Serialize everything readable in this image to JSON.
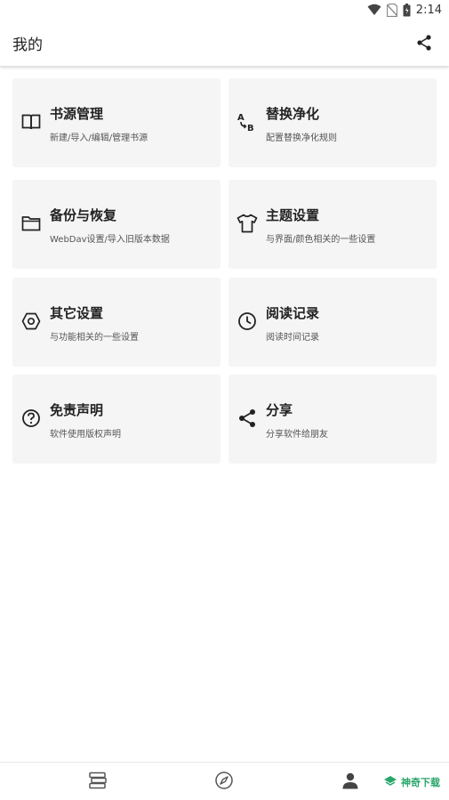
{
  "status_bar": {
    "time": "2:14"
  },
  "app_bar": {
    "title": "我的"
  },
  "cards": [
    {
      "title": "书源管理",
      "subtitle": "新建/导入/编辑/管理书源",
      "icon": "book-icon"
    },
    {
      "title": "替换净化",
      "subtitle": "配置替换净化规则",
      "icon": "replace-ab-icon"
    },
    {
      "title": "备份与恢复",
      "subtitle": "WebDav设置/导入旧版本数据",
      "icon": "folder-icon"
    },
    {
      "title": "主题设置",
      "subtitle": "与界面/颜色相关的一些设置",
      "icon": "shirt-icon"
    },
    {
      "title": "其它设置",
      "subtitle": "与功能相关的一些设置",
      "icon": "settings-hexagon-icon"
    },
    {
      "title": "阅读记录",
      "subtitle": "阅读时间记录",
      "icon": "clock-icon"
    },
    {
      "title": "免责声明",
      "subtitle": "软件使用版权声明",
      "icon": "question-circle-icon"
    },
    {
      "title": "分享",
      "subtitle": "分享软件给朋友",
      "icon": "share-icon"
    }
  ],
  "bottom_nav": {
    "items": [
      {
        "icon": "bookshelf-icon"
      },
      {
        "icon": "compass-icon"
      },
      {
        "icon": "person-icon",
        "active": true
      }
    ]
  },
  "watermark": {
    "text": "神奇下载"
  }
}
